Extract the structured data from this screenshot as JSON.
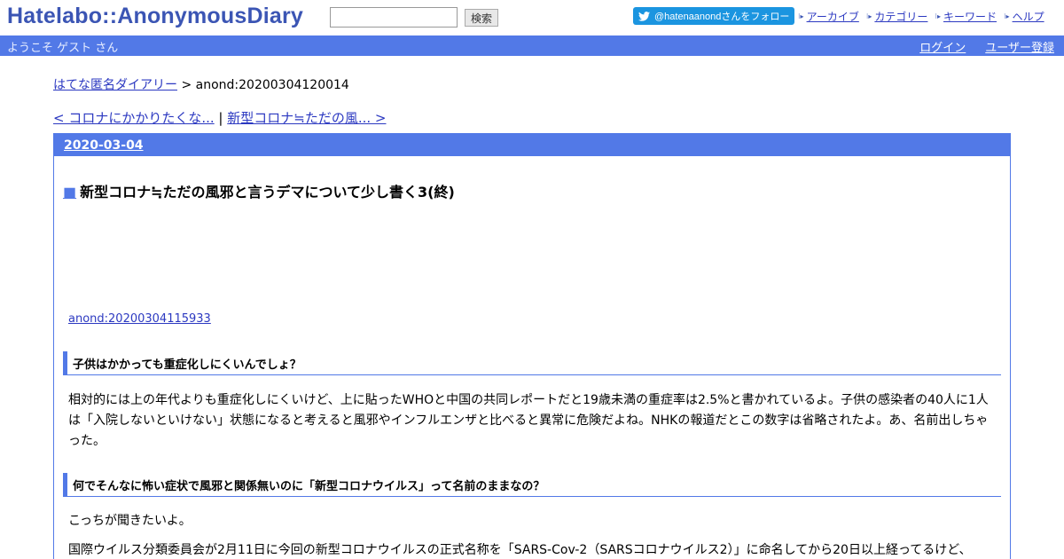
{
  "header": {
    "logo": "Hatelabo::AnonymousDiary",
    "search_value": "",
    "search_button": "検索",
    "twitter_follow": "@hatenaanondさんをフォロー",
    "links": [
      "アーカイブ",
      "カテゴリー",
      "キーワード",
      "ヘルプ"
    ]
  },
  "bar": {
    "welcome": "ようこそ ゲスト さん",
    "login": "ログイン",
    "register": "ユーザー登録"
  },
  "breadcrumb": {
    "home": "はてな匿名ダイアリー",
    "separator": " > ",
    "current": "anond:20200304120014"
  },
  "nav": {
    "prev": "< コロナにかかりたくな...",
    "divider": " | ",
    "next": "新型コロナ≒ただの風... >"
  },
  "day": {
    "date": "2020-03-04",
    "entry": {
      "square": "■",
      "title": "新型コロナ≒ただの風邪と言うデマについて少し書く3(終)",
      "ref_link": "anond:20200304115933",
      "sections": [
        {
          "heading": "子供はかかっても重症化しにくいんでしょ？",
          "paragraph": "相対的には上の年代よりも重症化しにくいけど、上に貼ったWHOと中国の共同レポートだと19歳未満の重症率は2.5%と書かれているよ。子供の感染者の40人に1人は「入院しないといけない」状態になると考えると風邪やインフルエンザと比べると異常に危険だよね。NHKの報道だとこの数字は省略されたよ。あ、名前出しちゃった。"
        },
        {
          "heading": "何でそんなに怖い症状で風邪と関係無いのに「新型コロナウイルス」って名前のままなの？",
          "paragraph": "こっちが聞きたいよ。"
        }
      ],
      "last_paragraph": "国際ウイルス分類委員会が2月11日に今回の新型コロナウイルスの正式名称を「SARS-Cov-2（SARSコロナウイルス2）」に命名してから20日以上経ってるけど、"
    }
  }
}
